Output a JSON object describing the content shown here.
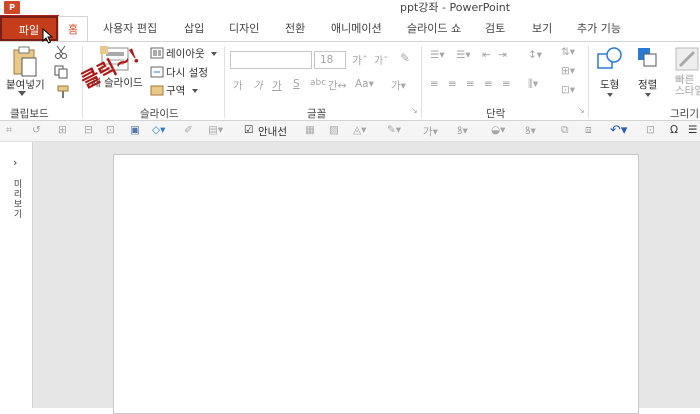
{
  "window": {
    "title": "ppt강좌 - PowerPoint",
    "app_icon": "P"
  },
  "tabs": [
    "파일",
    "홈",
    "사용자 편집",
    "삽입",
    "디자인",
    "전환",
    "애니메이션",
    "슬라이드 쇼",
    "검토",
    "보기",
    "추가 기능"
  ],
  "ribbon": {
    "clipboard": {
      "paste_label": "붙여넣기",
      "group_label": "클립보드"
    },
    "slides": {
      "new_slide_label": "새 슬라이드",
      "layout_label": "레이아웃",
      "reset_label": "다시 설정",
      "section_label": "구역",
      "group_label": "슬라이드"
    },
    "font": {
      "size_value": "18",
      "group_label": "글꼴"
    },
    "paragraph": {
      "group_label": "단락"
    },
    "drawing": {
      "shapes_label": "도형",
      "arrange_label": "정렬",
      "quick_styles_label": "빠른\n스타일",
      "group_label": "그리기"
    }
  },
  "qat": {
    "guides_label": "안내선",
    "guides_checked": true
  },
  "left_pane": {
    "vertical_label": "미리 보기"
  },
  "annotation": "클릭~!",
  "colors": {
    "file_tab": "#c43e1c",
    "home_tab_text": "#d24726",
    "annotation": "#b01818"
  }
}
